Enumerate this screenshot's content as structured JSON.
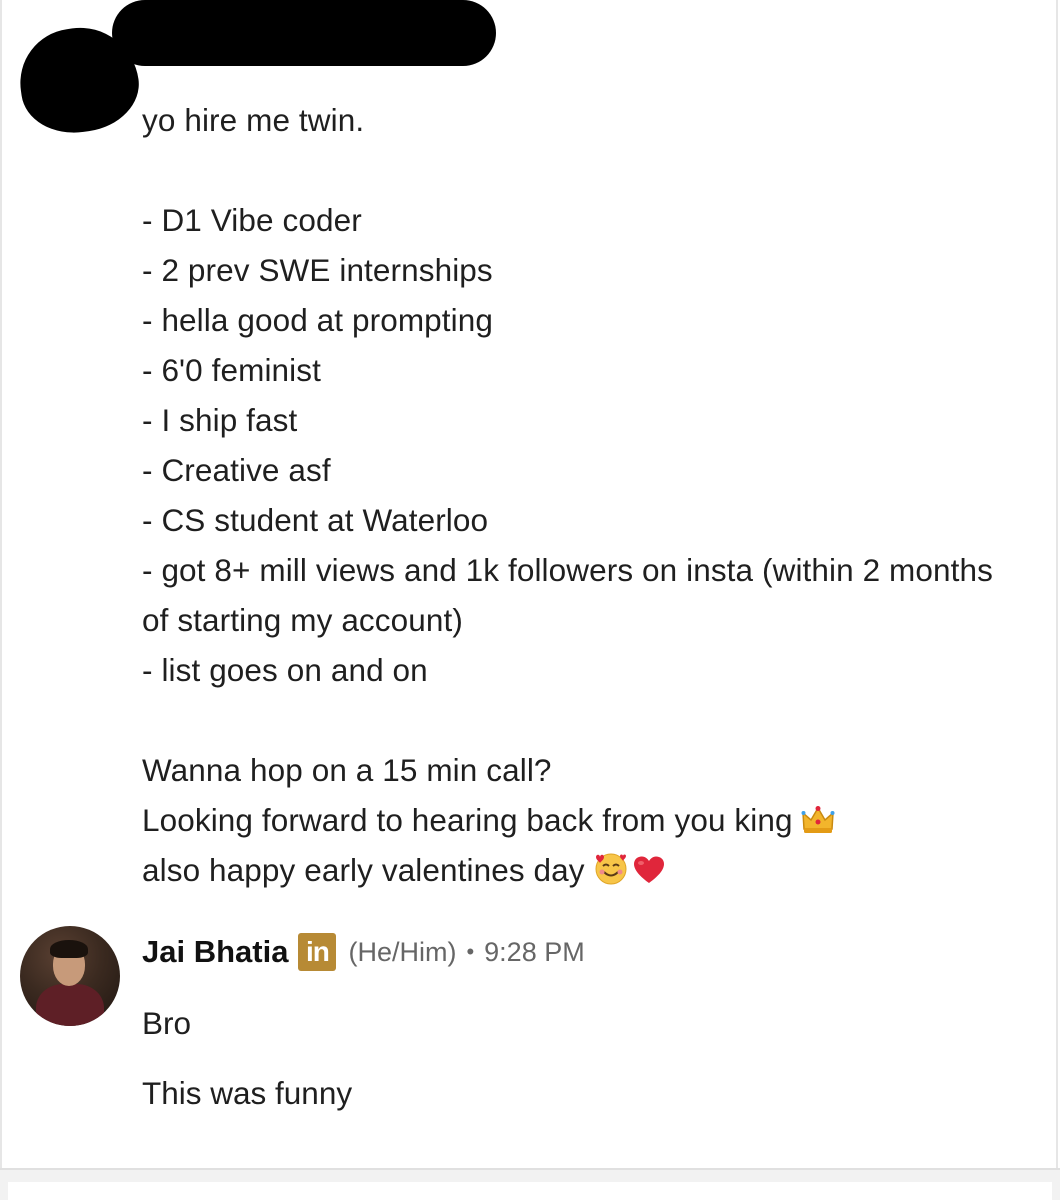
{
  "message": {
    "lines": [
      "yo hire me twin.",
      "- D1 Vibe coder",
      "- 2 prev SWE internships",
      "- hella good at prompting",
      "- 6'0 feminist",
      "- I ship fast",
      "- Creative asf",
      "- CS student at Waterloo",
      "- got 8+ mill views and 1k followers on insta (within 2 months of starting my account)",
      "- list goes on and on",
      "Wanna hop on a 15 min call?",
      "Looking forward to hearing back from you king",
      "also happy early valentines day"
    ]
  },
  "icons": {
    "crown": "crown-icon",
    "smile_hearts": "smiling-face-with-hearts-icon",
    "heart": "red-heart-icon"
  },
  "reply": {
    "name": "Jai Bhatia",
    "badge": "in",
    "pronouns": "(He/Him)",
    "separator": "•",
    "time": "9:28 PM",
    "messages": [
      "Bro",
      "This was funny"
    ]
  },
  "colors": {
    "badge": "#b78a35",
    "meta_text": "#666666",
    "heart": "#e0263b"
  }
}
